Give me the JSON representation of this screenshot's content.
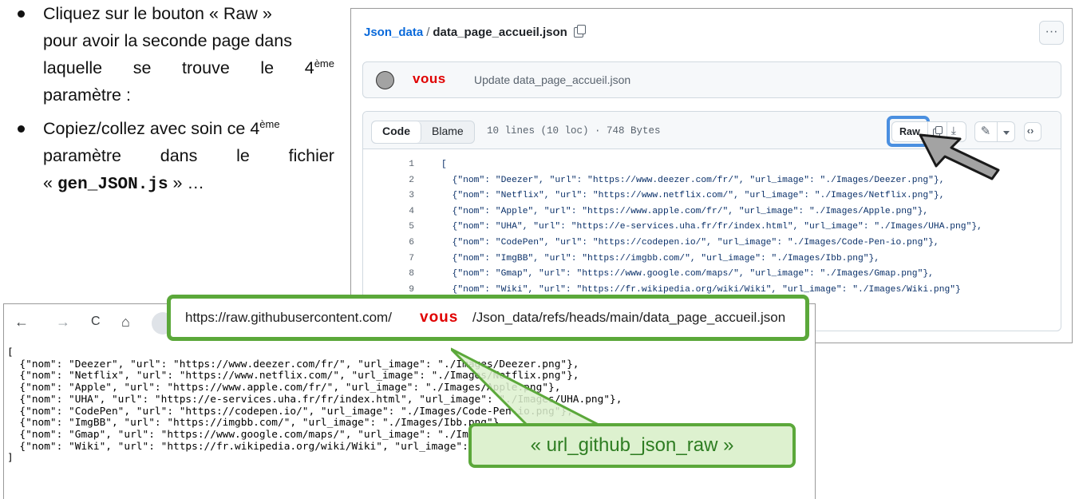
{
  "instructions": {
    "b1_l1": "Cliquez sur le bouton « Raw »",
    "b1_l2": "pour avoir la seconde page dans",
    "b1_l3_w1": "laquelle",
    "b1_l3_w2": "se",
    "b1_l3_w3": "trouve",
    "b1_l3_w4": "le",
    "b1_l3_num": "4",
    "b1_l3_sup": "ème",
    "b1_l4": "paramètre :",
    "b2_l1": "Copiez/collez avec soin ce 4",
    "b2_l1_sup": "ème",
    "b2_l2_w1": "paramètre",
    "b2_l2_w2": "dans",
    "b2_l2_w3": "le",
    "b2_l2_w4": "fichier",
    "b2_l3_open": "« ",
    "b2_l3_file": "gen_JSON.js",
    "b2_l3_close": " » …"
  },
  "github": {
    "repo": "Json_data",
    "separator": "/",
    "file": "data_page_accueil.json",
    "more_label": "···",
    "commit_author": "vous",
    "commit_message": "Update data_page_accueil.json",
    "tab_code": "Code",
    "tab_blame": "Blame",
    "file_info": "10 lines (10 loc) · 748 Bytes",
    "raw_label": "Raw",
    "lines": [
      {
        "n": "1",
        "t": "["
      },
      {
        "n": "2",
        "t": "  {\"nom\": \"Deezer\", \"url\": \"https://www.deezer.com/fr/\", \"url_image\": \"./Images/Deezer.png\"},"
      },
      {
        "n": "3",
        "t": "  {\"nom\": \"Netflix\", \"url\": \"https://www.netflix.com/\", \"url_image\": \"./Images/Netflix.png\"},"
      },
      {
        "n": "4",
        "t": "  {\"nom\": \"Apple\", \"url\": \"https://www.apple.com/fr/\", \"url_image\": \"./Images/Apple.png\"},"
      },
      {
        "n": "5",
        "t": "  {\"nom\": \"UHA\", \"url\": \"https://e-services.uha.fr/fr/index.html\", \"url_image\": \"./Images/UHA.png\"},"
      },
      {
        "n": "6",
        "t": "  {\"nom\": \"CodePen\", \"url\": \"https://codepen.io/\", \"url_image\": \"./Images/Code-Pen-io.png\"},"
      },
      {
        "n": "7",
        "t": "  {\"nom\": \"ImgBB\", \"url\": \"https://imgbb.com/\", \"url_image\": \"./Images/Ibb.png\"},"
      },
      {
        "n": "8",
        "t": "  {\"nom\": \"Gmap\", \"url\": \"https://www.google.com/maps/\", \"url_image\": \"./Images/Gmap.png\"},"
      },
      {
        "n": "9",
        "t": "  {\"nom\": \"Wiki\", \"url\": \"https://fr.wikipedia.org/wiki/Wiki\", \"url_image\": \"./Images/Wiki.png\"}"
      }
    ]
  },
  "browser": {
    "back": "←",
    "forward": "→",
    "reload": "C",
    "home": "⌂",
    "url_host": "https://raw.githubusercontent.com/",
    "url_user": "vous",
    "url_path": "/Json_data/refs/heads/main/data_page_accueil.json",
    "raw_content": "[\n  {\"nom\": \"Deezer\", \"url\": \"https://www.deezer.com/fr/\", \"url_image\": \"./Images/Deezer.png\"},\n  {\"nom\": \"Netflix\", \"url\": \"https://www.netflix.com/\", \"url_image\": \"./Images/Netflix.png\"},\n  {\"nom\": \"Apple\", \"url\": \"https://www.apple.com/fr/\", \"url_image\": \"./Images/Apple.png\"},\n  {\"nom\": \"UHA\", \"url\": \"https://e-services.uha.fr/fr/index.html\", \"url_image\": \"./Images/UHA.png\"},\n  {\"nom\": \"CodePen\", \"url\": \"https://codepen.io/\", \"url_image\": \"./Images/Code-Pen-io.png\"},\n  {\"nom\": \"ImgBB\", \"url\": \"https://imgbb.com/\", \"url_image\": \"./Images/Ibb.png\"},\n  {\"nom\": \"Gmap\", \"url\": \"https://www.google.com/maps/\", \"url_image\": \"./Images/Gmap.png\"},\n  {\"nom\": \"Wiki\", \"url\": \"https://fr.wikipedia.org/wiki/Wiki\", \"url_image\": \"./Images/Wiki.png\"}\n]"
  },
  "callout": {
    "label": "« url_github_json_raw »"
  },
  "colors": {
    "highlight_blue": "#4a8fe0",
    "highlight_green": "#5ba83a",
    "callout_fill": "#ddf1cf",
    "user_red": "#e00000",
    "link_blue": "#0969da"
  }
}
